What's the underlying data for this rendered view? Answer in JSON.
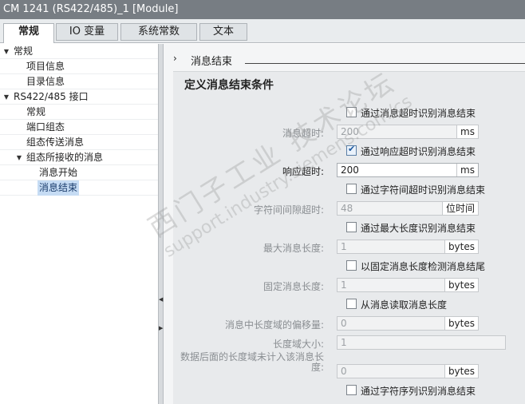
{
  "window": {
    "title": "CM 1241 (RS422/485)_1 [Module]"
  },
  "tabs": [
    {
      "label": "常规",
      "active": true
    },
    {
      "label": "IO 变量",
      "active": false
    },
    {
      "label": "系统常数",
      "active": false
    },
    {
      "label": "文本",
      "active": false
    }
  ],
  "tree": [
    {
      "label": "常规",
      "expanded": true
    },
    {
      "label": "项目信息"
    },
    {
      "label": "目录信息"
    },
    {
      "label": "RS422/485 接口",
      "expanded": true
    },
    {
      "label": "常规"
    },
    {
      "label": "端口组态"
    },
    {
      "label": "组态传送消息"
    },
    {
      "label": "组态所接收的消息",
      "expanded": true
    },
    {
      "label": "消息开始"
    },
    {
      "label": "消息结束",
      "selected": true
    }
  ],
  "section": {
    "title": "消息结束"
  },
  "panel": {
    "title": "定义消息结束条件",
    "timeout_check": {
      "label": "通过消息超时识别消息结束",
      "checked": false
    },
    "timeout_field": {
      "label": "消息超时:",
      "value": "200",
      "unit": "ms"
    },
    "response_check": {
      "label": "通过响应超时识别消息结束",
      "checked": true
    },
    "response_field": {
      "label": "响应超时:",
      "value": "200",
      "unit": "ms"
    },
    "gap_check": {
      "label": "通过字符间超时识别消息结束",
      "checked": false
    },
    "gap_field": {
      "label": "字符间间隙超时:",
      "value": "48",
      "unit": "位时间"
    },
    "maxlen_check": {
      "label": "通过最大长度识别消息结束",
      "checked": false
    },
    "maxlen_field": {
      "label": "最大消息长度:",
      "value": "1",
      "unit": "bytes"
    },
    "fixed_check": {
      "label": "以固定消息长度检测消息结尾",
      "checked": false
    },
    "fixed_field": {
      "label": "固定消息长度:",
      "value": "1",
      "unit": "bytes"
    },
    "read_check": {
      "label": "从消息读取消息长度",
      "checked": false
    },
    "offset_field": {
      "label": "消息中长度域的偏移量:",
      "value": "0",
      "unit": "bytes"
    },
    "lensize_field": {
      "label": "长度域大小:",
      "value": "1"
    },
    "trailing_field": {
      "label": "数据后面的长度域未计入该消息长度:",
      "value": "0",
      "unit": "bytes"
    },
    "sequence_check": {
      "label": "通过字符序列识别消息结束",
      "checked": false
    }
  },
  "watermark": {
    "line1": "西门子工业 技术论坛",
    "line2": "support.industry.siemens.com/cs"
  }
}
